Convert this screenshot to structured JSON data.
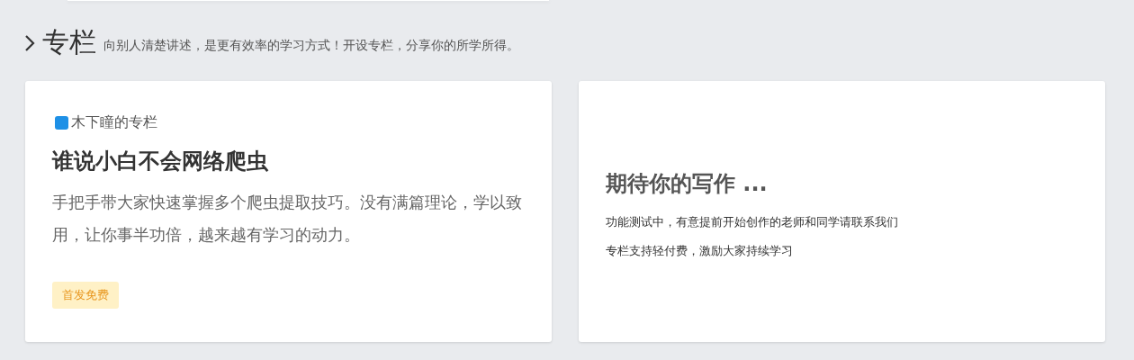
{
  "section": {
    "title": "专栏",
    "subtitle": "向别人清楚讲述，是更有效率的学习方式！开设专栏，分享你的所学所得。"
  },
  "cards": [
    {
      "kind": "column",
      "column_name": "木下瞳的专栏",
      "title": "谁说小白不会网络爬虫",
      "description": "手把手带大家快速掌握多个爬虫提取技巧。没有满篇理论，学以致用，让你事半功倍，越来越有学习的动力。",
      "tag": "首发免费"
    },
    {
      "kind": "invite",
      "title": "期待你的写作 ...",
      "lines": [
        "功能测试中，有意提前开始创作的老师和同学请联系我们",
        "专栏支持轻付费，激励大家持续学习"
      ]
    }
  ]
}
